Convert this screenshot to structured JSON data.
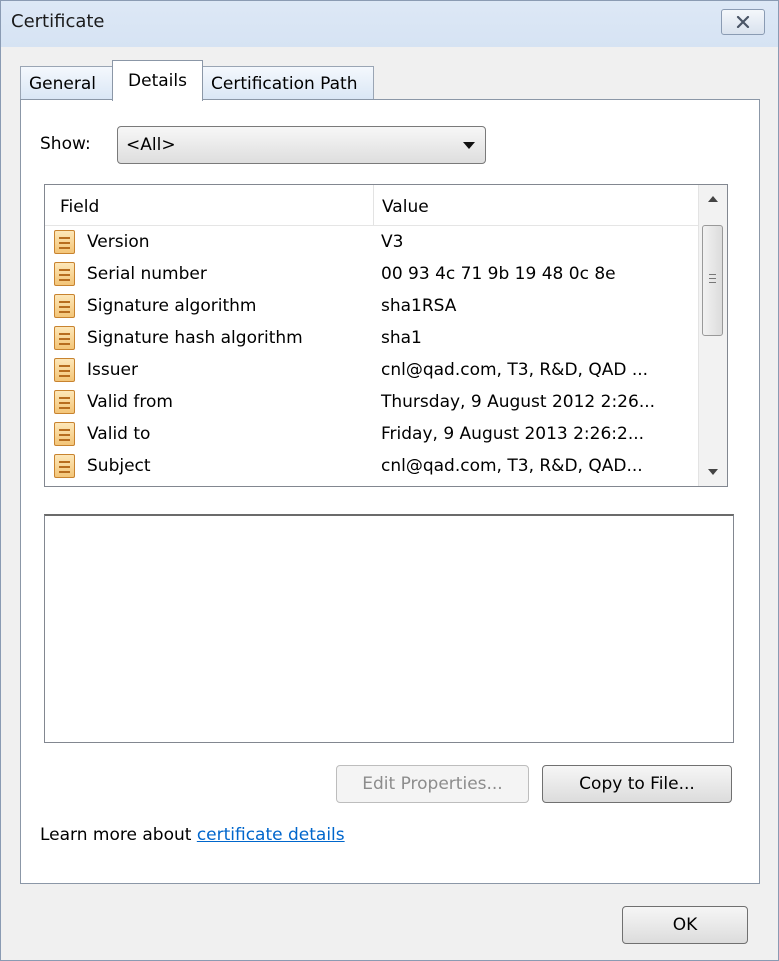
{
  "window": {
    "title": "Certificate"
  },
  "tabs": [
    {
      "label": "General"
    },
    {
      "label": "Details"
    },
    {
      "label": "Certification Path"
    }
  ],
  "show": {
    "label": "Show:",
    "selected": "<All>"
  },
  "list": {
    "columns": {
      "field": "Field",
      "value": "Value"
    },
    "rows": [
      {
        "field": "Version",
        "value": "V3"
      },
      {
        "field": "Serial number",
        "value": "00 93 4c 71 9b 19 48 0c 8e"
      },
      {
        "field": "Signature algorithm",
        "value": "sha1RSA"
      },
      {
        "field": "Signature hash algorithm",
        "value": "sha1"
      },
      {
        "field": "Issuer",
        "value": "cnl@qad.com, T3, R&D, QAD ..."
      },
      {
        "field": "Valid from",
        "value": "Thursday, 9 August 2012 2:26..."
      },
      {
        "field": "Valid to",
        "value": "Friday, 9 August 2013 2:26:2..."
      },
      {
        "field": "Subject",
        "value": "cnl@qad.com, T3, R&D, QAD..."
      }
    ]
  },
  "buttons": {
    "edit_properties": "Edit Properties...",
    "copy_to_file": "Copy to File...",
    "ok": "OK"
  },
  "learn_more": {
    "prefix": "Learn more about ",
    "link": "certificate details"
  }
}
